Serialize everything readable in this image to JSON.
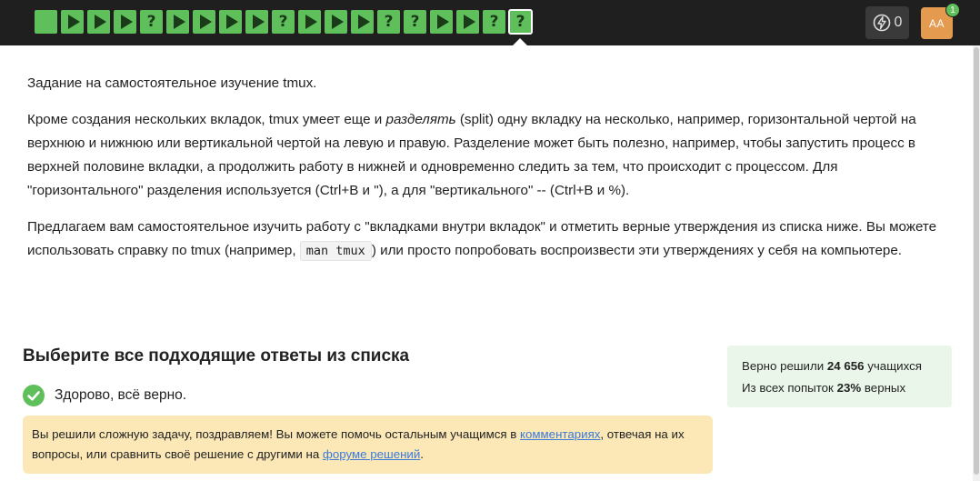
{
  "topbar": {
    "steps": [
      {
        "kind": "lesson",
        "current": false
      },
      {
        "kind": "video",
        "current": false
      },
      {
        "kind": "video",
        "current": false
      },
      {
        "kind": "video",
        "current": false
      },
      {
        "kind": "quiz",
        "current": false
      },
      {
        "kind": "video",
        "current": false
      },
      {
        "kind": "video",
        "current": false
      },
      {
        "kind": "video",
        "current": false
      },
      {
        "kind": "video",
        "current": false
      },
      {
        "kind": "quiz",
        "current": false
      },
      {
        "kind": "video",
        "current": false
      },
      {
        "kind": "video",
        "current": false
      },
      {
        "kind": "video",
        "current": false
      },
      {
        "kind": "quiz",
        "current": false
      },
      {
        "kind": "quiz",
        "current": false
      },
      {
        "kind": "video",
        "current": false
      },
      {
        "kind": "video",
        "current": false
      },
      {
        "kind": "quiz",
        "current": false
      },
      {
        "kind": "quiz",
        "current": true
      }
    ],
    "step_color": "#5fbf5a",
    "energy_value": "0",
    "energy_icon": "lightning-bolt-icon",
    "avatar_initials": "AA",
    "avatar_color": "#e49a4f",
    "notification_count": "1"
  },
  "task": {
    "intro": "Задание на самостоятельное изучение tmux.",
    "p2_a": "Кроме создания нескольких вкладок, tmux умеет еще и ",
    "p2_em": "разделять",
    "p2_b": " (split) одну вкладку на несколько, например, горизонтальной чертой на верхнюю и нижнюю или вертикальной чертой на левую и правую. Разделение может быть полезно, например, чтобы запустить процесс в верхней половине вкладки, а продолжить работу в нижней и одновременно следить за тем, что происходит с процессом. Для \"горизонтального\" разделения используется (Ctrl+B и \"), а для \"вертикального\" -- (Ctrl+B и %).",
    "p3_a": "Предлагаем вам самостоятельное изучить работу с \"вкладками внутри вкладок\" и отметить верные утверждения из списка ниже. Вы можете использовать справку по tmux (например, ",
    "p3_code": "man tmux",
    "p3_b": ") или просто попробовать воспроизвести эти утверждениях у себя на компьютере."
  },
  "quiz": {
    "title": "Выберите все подходящие ответы из списка",
    "status_text": "Здорово, всё верно.",
    "status_icon": "check-circle-icon",
    "status_color": "#5fbf5a"
  },
  "congrats": {
    "text_a": "Вы решили сложную задачу, поздравляем! Вы можете помочь остальным учащимся в ",
    "link_comments": "комментариях",
    "text_b": ", отвечая на их вопросы, или сравнить своё решение с другими на ",
    "link_forum": "форуме решений",
    "text_c": ".",
    "bg_color": "#fbe8b6"
  },
  "stats": {
    "solved_prefix": "Верно решили ",
    "solved_count": "24 656",
    "solved_suffix": " учащихся",
    "attempts_prefix": "Из всех попыток ",
    "attempts_percent": "23%",
    "attempts_suffix": " верных"
  }
}
